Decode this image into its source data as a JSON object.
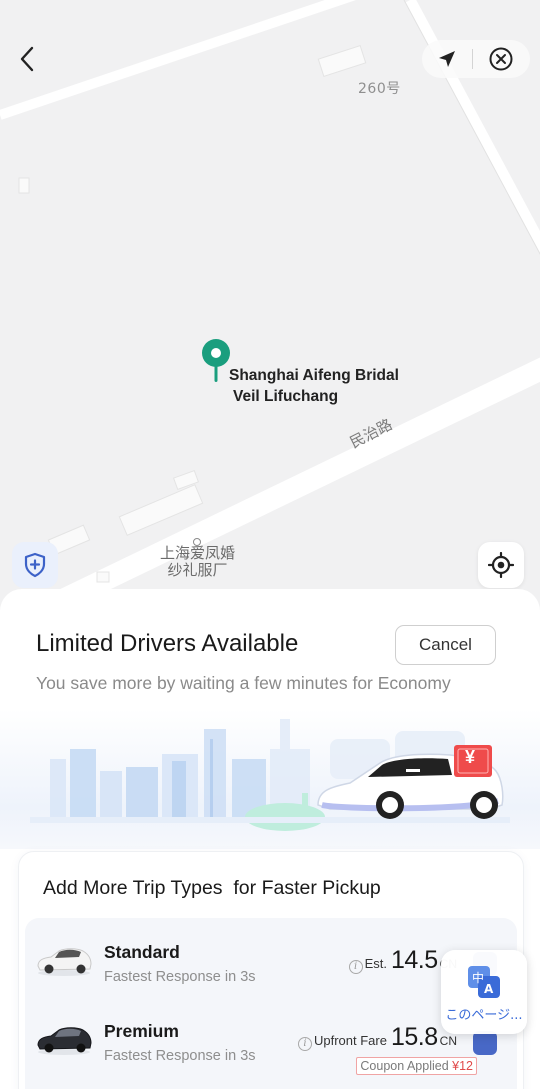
{
  "map": {
    "building_number": "260号",
    "road_name": "民治路",
    "destination": {
      "name_line1": "Shanghai Aifeng Bridal",
      "name_line2": "Veil Lifuchang"
    },
    "poi_cn_line1": "上海爱凤婚",
    "poi_cn_line2": "纱礼服厂"
  },
  "header": {
    "back_icon": "chevron-left-icon",
    "navigate_icon": "navigation-arrow-icon",
    "close_icon": "close-circle-icon"
  },
  "sheet": {
    "title": "Limited Drivers Available",
    "subtitle": "You save more by waiting a few minutes for Economy",
    "cancel_label": "Cancel",
    "illustration_badge": "¥"
  },
  "card": {
    "title": "Add More Trip Types  for Faster Pickup",
    "trips": [
      {
        "name": "Standard",
        "desc": "Fastest Response in 3s",
        "price_label": "Est.",
        "price": "14.5",
        "currency": "CN",
        "car_color": "white"
      },
      {
        "name": "Premium",
        "desc": "Fastest Response in 3s",
        "price_label": "Upfront Fare",
        "price": "15.8",
        "currency": "CN",
        "coupon_label": "Coupon Applied ",
        "coupon_value": "¥12",
        "car_color": "black"
      }
    ]
  },
  "translate": {
    "label": "このページ..."
  },
  "colors": {
    "pin": "#1a9e7e",
    "accent_blue": "#4868c6",
    "coupon_red": "#e04a4a"
  }
}
